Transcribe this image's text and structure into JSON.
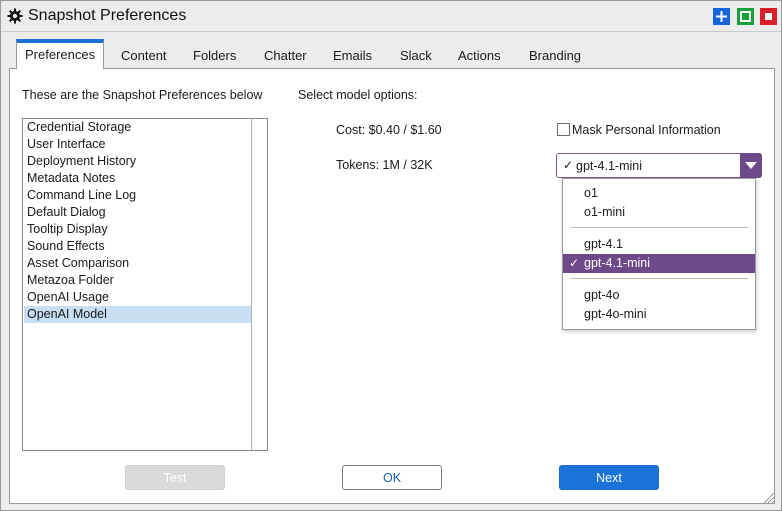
{
  "window": {
    "title": "Snapshot Preferences"
  },
  "tabs": [
    {
      "label": "Preferences",
      "active": true
    },
    {
      "label": "Content"
    },
    {
      "label": "Folders"
    },
    {
      "label": "Chatter"
    },
    {
      "label": "Emails"
    },
    {
      "label": "Slack"
    },
    {
      "label": "Actions"
    },
    {
      "label": "Branding"
    }
  ],
  "left": {
    "heading": "These are the Snapshot Preferences below",
    "items": [
      "Credential Storage",
      "User Interface",
      "Deployment History",
      "Metadata Notes",
      "Command Line Log",
      "Default Dialog",
      "Tooltip Display",
      "Sound Effects",
      "Asset Comparison",
      "Metazoa Folder",
      "OpenAI Usage",
      "OpenAI Model"
    ],
    "selected_item": "OpenAI Model"
  },
  "right": {
    "heading": "Select model options:",
    "cost": "Cost: $0.40 / $1.60",
    "tokens": "Tokens: 1M / 32K",
    "mask_label": "Mask Personal Information",
    "mask_checked": false,
    "model_select": {
      "checkmark": "✓",
      "value": "gpt-4.1-mini",
      "options": [
        "o1",
        "o1-mini",
        "gpt-4.1",
        "gpt-4.1-mini",
        "gpt-4o",
        "gpt-4o-mini"
      ]
    }
  },
  "buttons": {
    "test": "Test",
    "ok": "OK",
    "next": "Next"
  },
  "colors": {
    "accent_blue": "#1a73d9",
    "selection_purple": "#6e4a8a",
    "list_selection": "#c7def3"
  }
}
